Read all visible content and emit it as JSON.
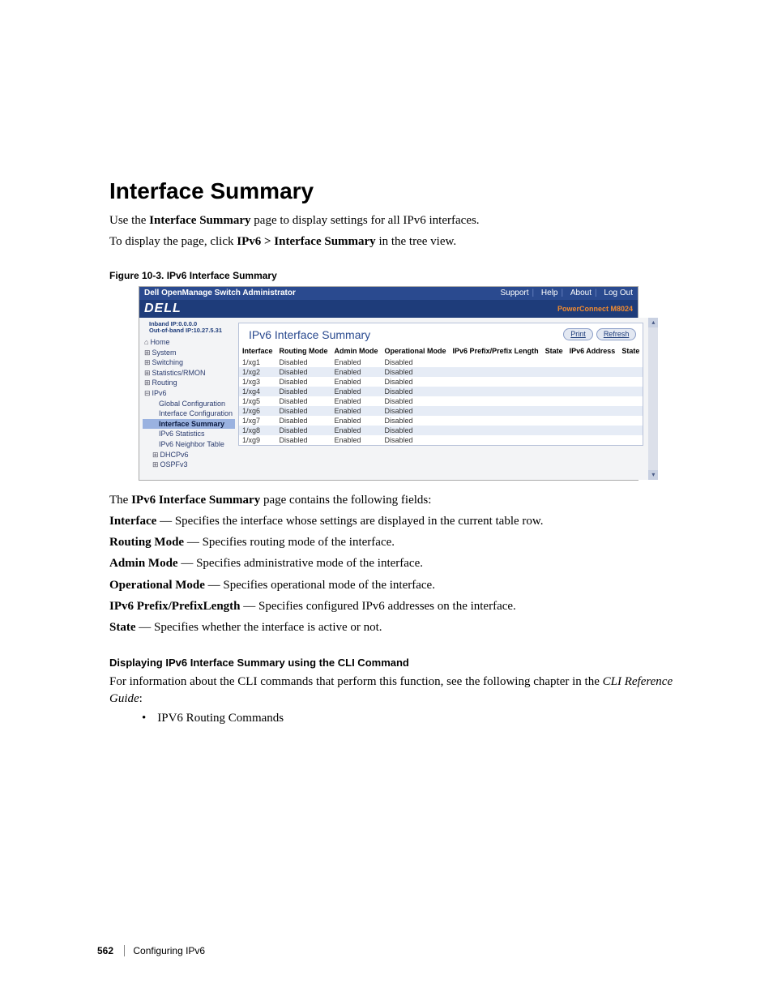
{
  "doc": {
    "heading": "Interface Summary",
    "intro1_pre": "Use the ",
    "intro1_bold": "Interface Summary",
    "intro1_post": " page to display settings for all IPv6 interfaces.",
    "intro2_pre": "To display the page, click ",
    "intro2_bold": "IPv6 > Interface Summary",
    "intro2_post": " in the tree view.",
    "fig_caption": "Figure 10-3.    IPv6 Interface Summary",
    "after_pre": "The ",
    "after_bold": "IPv6 Interface Summary",
    "after_post": " page contains the following fields:",
    "fields": [
      {
        "label": "Interface",
        "desc": " — Specifies the interface whose settings are displayed in the current table row."
      },
      {
        "label": "Routing Mode",
        "desc": " — Specifies routing mode of the interface."
      },
      {
        "label": "Admin Mode",
        "desc": " — Specifies administrative mode of the interface."
      },
      {
        "label": "Operational Mode",
        "desc": " — Specifies operational mode of the interface."
      },
      {
        "label": "IPv6 Prefix/PrefixLength",
        "desc": " — Specifies configured IPv6 addresses on the interface."
      },
      {
        "label": "State",
        "desc": " — Specifies whether the interface is active or not."
      }
    ],
    "cli_head": "Displaying IPv6 Interface Summary using the CLI Command",
    "cli_para_pre": "For information about the CLI commands that perform this function, see the following chapter in the ",
    "cli_para_em": "CLI Reference Guide",
    "cli_para_post": ":",
    "cli_bullet": "IPV6 Routing Commands",
    "page_number": "562",
    "page_section": "Configuring IPv6"
  },
  "shot": {
    "app_title": "Dell OpenManage Switch Administrator",
    "links": {
      "support": "Support",
      "help": "Help",
      "about": "About",
      "logout": "Log Out"
    },
    "model": "PowerConnect M8024",
    "logo_text": "DELL",
    "ip_inband": "Inband IP:0.0.0.0",
    "ip_outband": "Out-of-band IP:10.27.5.31",
    "nav": {
      "home": "Home",
      "system": "System",
      "switching": "Switching",
      "stats": "Statistics/RMON",
      "routing": "Routing",
      "ipv6": "IPv6",
      "global": "Global Configuration",
      "ifconf": "Interface Configuration",
      "ifsum": "Interface Summary",
      "ipv6stats": "IPv6 Statistics",
      "neighbor": "IPv6 Neighbor Table",
      "dhcpv6": "DHCPv6",
      "ospfv3": "OSPFv3"
    },
    "pane": {
      "title": "IPv6 Interface Summary",
      "print": "Print",
      "refresh": "Refresh",
      "columns": [
        "Interface",
        "Routing Mode",
        "Admin Mode",
        "Operational Mode",
        "IPv6 Prefix/Prefix Length",
        "State",
        "IPv6 Address",
        "State"
      ],
      "rows": [
        {
          "iface": "1/xg1",
          "rm": "Disabled",
          "am": "Enabled",
          "om": "Disabled"
        },
        {
          "iface": "1/xg2",
          "rm": "Disabled",
          "am": "Enabled",
          "om": "Disabled"
        },
        {
          "iface": "1/xg3",
          "rm": "Disabled",
          "am": "Enabled",
          "om": "Disabled"
        },
        {
          "iface": "1/xg4",
          "rm": "Disabled",
          "am": "Enabled",
          "om": "Disabled"
        },
        {
          "iface": "1/xg5",
          "rm": "Disabled",
          "am": "Enabled",
          "om": "Disabled"
        },
        {
          "iface": "1/xg6",
          "rm": "Disabled",
          "am": "Enabled",
          "om": "Disabled"
        },
        {
          "iface": "1/xg7",
          "rm": "Disabled",
          "am": "Enabled",
          "om": "Disabled"
        },
        {
          "iface": "1/xg8",
          "rm": "Disabled",
          "am": "Enabled",
          "om": "Disabled"
        },
        {
          "iface": "1/xg9",
          "rm": "Disabled",
          "am": "Enabled",
          "om": "Disabled"
        }
      ]
    }
  }
}
